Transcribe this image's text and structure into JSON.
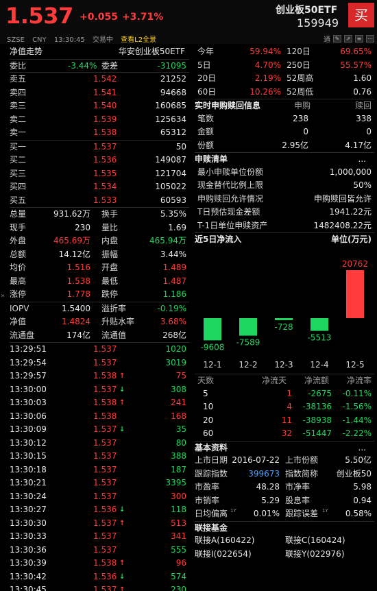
{
  "header": {
    "price": "1.537",
    "change": "+0.055",
    "change_pct": "+3.71%",
    "fund_name": "创业板50ETF",
    "code": "159949",
    "buy_label": "买",
    "exchange": "SZSE",
    "currency": "CNY",
    "time": "13:30:45",
    "status": "交易中",
    "l2_link": "查看L2全景",
    "tool_label": "通",
    "tool_icons": [
      "pencil-icon",
      "link-icon",
      "menu-icon",
      "more-icon"
    ]
  },
  "left": {
    "title": "净值走势",
    "subtitle": "华安创业板50ETF",
    "weibi_label": "委比",
    "weibi": "-3.44%",
    "weicha_label": "委差",
    "weicha": "-31095",
    "asks": [
      {
        "label": "卖五",
        "price": "1.542",
        "vol": "21252"
      },
      {
        "label": "卖四",
        "price": "1.541",
        "vol": "94668"
      },
      {
        "label": "卖三",
        "price": "1.540",
        "vol": "160685"
      },
      {
        "label": "卖二",
        "price": "1.539",
        "vol": "125634"
      },
      {
        "label": "卖一",
        "price": "1.538",
        "vol": "65312"
      }
    ],
    "bids": [
      {
        "label": "买一",
        "price": "1.537",
        "vol": "50"
      },
      {
        "label": "买二",
        "price": "1.536",
        "vol": "149087"
      },
      {
        "label": "买三",
        "price": "1.535",
        "vol": "121704"
      },
      {
        "label": "买四",
        "price": "1.534",
        "vol": "105022"
      },
      {
        "label": "买五",
        "price": "1.533",
        "vol": "60593"
      }
    ],
    "stats": [
      {
        "l1": "总量",
        "v1": "931.62万",
        "c1": "white",
        "l2": "换手",
        "v2": "5.35%",
        "c2": "white"
      },
      {
        "l1": "现手",
        "v1": "230",
        "c1": "white",
        "l2": "量比",
        "v2": "1.69",
        "c2": "white"
      },
      {
        "l1": "外盘",
        "v1": "465.69万",
        "c1": "red",
        "l2": "内盘",
        "v2": "465.94万",
        "c2": "green"
      },
      {
        "l1": "总额",
        "v1": "14.12亿",
        "c1": "white",
        "l2": "振幅",
        "v2": "3.44%",
        "c2": "white"
      },
      {
        "l1": "均价",
        "v1": "1.516",
        "c1": "red",
        "l2": "开盘",
        "v2": "1.489",
        "c2": "red"
      },
      {
        "l1": "最高",
        "v1": "1.538",
        "c1": "red",
        "l2": "最低",
        "v2": "1.487",
        "c2": "red"
      },
      {
        "l1": "涨停",
        "v1": "1.778",
        "c1": "red",
        "l2": "跌停",
        "v2": "1.186",
        "c2": "green"
      }
    ],
    "iopv": [
      {
        "l1": "IOPV",
        "v1": "1.5400",
        "c1": "white",
        "l2": "溢折率",
        "v2": "-0.19%",
        "c2": "green"
      },
      {
        "l1": "净值",
        "v1": "1.4824",
        "c1": "red",
        "l2": "升贴水率",
        "v2": "3.68%",
        "c2": "red"
      },
      {
        "l1": "流通盘",
        "v1": "174亿",
        "c1": "white",
        "l2": "流通值",
        "v2": "268亿",
        "c2": "white"
      }
    ],
    "ticks": [
      {
        "t": "13:29:51",
        "p": "1.537",
        "arrow": "",
        "v": "1020",
        "vc": "green"
      },
      {
        "t": "13:29:54",
        "p": "1.537",
        "arrow": "",
        "v": "3019",
        "vc": "green"
      },
      {
        "t": "13:29:57",
        "p": "1.538",
        "arrow": "up",
        "v": "75",
        "vc": "red"
      },
      {
        "t": "13:30:00",
        "p": "1.537",
        "arrow": "down",
        "v": "308",
        "vc": "green"
      },
      {
        "t": "13:30:03",
        "p": "1.538",
        "arrow": "up",
        "v": "241",
        "vc": "red"
      },
      {
        "t": "13:30:06",
        "p": "1.538",
        "arrow": "",
        "v": "168",
        "vc": "red"
      },
      {
        "t": "13:30:09",
        "p": "1.537",
        "arrow": "down",
        "v": "35",
        "vc": "green"
      },
      {
        "t": "13:30:12",
        "p": "1.537",
        "arrow": "",
        "v": "80",
        "vc": "green"
      },
      {
        "t": "13:30:15",
        "p": "1.537",
        "arrow": "",
        "v": "388",
        "vc": "green"
      },
      {
        "t": "13:30:18",
        "p": "1.537",
        "arrow": "",
        "v": "187",
        "vc": "green"
      },
      {
        "t": "13:30:21",
        "p": "1.537",
        "arrow": "",
        "v": "3395",
        "vc": "green"
      },
      {
        "t": "13:30:24",
        "p": "1.537",
        "arrow": "",
        "v": "300",
        "vc": "red"
      },
      {
        "t": "13:30:27",
        "p": "1.536",
        "arrow": "down",
        "v": "118",
        "vc": "green"
      },
      {
        "t": "13:30:30",
        "p": "1.537",
        "arrow": "up",
        "v": "513",
        "vc": "red"
      },
      {
        "t": "13:30:33",
        "p": "1.537",
        "arrow": "",
        "v": "341",
        "vc": "red"
      },
      {
        "t": "13:30:36",
        "p": "1.537",
        "arrow": "",
        "v": "555",
        "vc": "green"
      },
      {
        "t": "13:30:39",
        "p": "1.538",
        "arrow": "up",
        "v": "96",
        "vc": "red"
      },
      {
        "t": "13:30:42",
        "p": "1.536",
        "arrow": "down",
        "v": "574",
        "vc": "green"
      },
      {
        "t": "13:30:45",
        "p": "1.537",
        "arrow": "up",
        "v": "230",
        "vc": "green"
      }
    ]
  },
  "right": {
    "perf": [
      {
        "l1": "今年",
        "v1": "59.94%",
        "l2": "120日",
        "v2": "69.65%",
        "c2": "red"
      },
      {
        "l1": "5日",
        "v1": "4.70%",
        "l2": "250日",
        "v2": "55.57%",
        "c2": "red"
      },
      {
        "l1": "20日",
        "v1": "2.19%",
        "l2": "52周高",
        "v2": "1.60",
        "c2": "white"
      },
      {
        "l1": "60日",
        "v1": "10.26%",
        "l2": "52周低",
        "v2": "0.76",
        "c2": "white"
      }
    ],
    "realtime": {
      "title": "实时申购赎回信息",
      "col1": "申购",
      "col2": "赎回",
      "rows": [
        {
          "label": "笔数",
          "a": "238",
          "b": "338"
        },
        {
          "label": "金额",
          "a": "0",
          "b": "0"
        },
        {
          "label": "份额",
          "a": "2.95亿",
          "b": "4.17亿"
        }
      ]
    },
    "list": {
      "title": "申赎清单",
      "more": "...",
      "rows": [
        {
          "label": "最小申赎单位份额",
          "value": "1,000,000"
        },
        {
          "label": "现金替代比例上限",
          "value": "50%"
        },
        {
          "label": "申购赎回允许情况",
          "value": "申购赎回皆允许"
        },
        {
          "label": "T日预估现金差额",
          "value": "1941.22元"
        },
        {
          "label": "T-1日单位申赎资产",
          "value": "1482408.22元"
        }
      ]
    },
    "flow": {
      "title": "近5日净流入",
      "unit": "单位(万元)",
      "dates": [
        "12-1",
        "12-2",
        "12-3",
        "12-4",
        "12-5"
      ]
    },
    "flow_table": {
      "headers": [
        "天数",
        "净流天",
        "净流额",
        "净流率"
      ],
      "rows": [
        {
          "d": "5",
          "n": "1",
          "amt": "-2675",
          "rate": "-0.11%"
        },
        {
          "d": "10",
          "n": "4",
          "amt": "-38136",
          "rate": "-1.56%"
        },
        {
          "d": "20",
          "n": "11",
          "amt": "-38938",
          "rate": "-1.44%"
        },
        {
          "d": "60",
          "n": "32",
          "amt": "-51447",
          "rate": "-2.22%"
        }
      ]
    },
    "basic": {
      "title": "基本资料",
      "more": "...",
      "rows": [
        {
          "l1": "上市日期",
          "v1": "2016-07-22",
          "c1": "white",
          "l2": "上市份额",
          "v2": "5.50亿"
        },
        {
          "l1": "跟踪指数",
          "v1": "399673",
          "c1": "blue",
          "l2": "指数简称",
          "v2": "创业板50"
        },
        {
          "l1": "市盈率",
          "v1": "48.28",
          "c1": "white",
          "l2": "市净率",
          "v2": "5.98"
        },
        {
          "l1": "市销率",
          "v1": "5.29",
          "c1": "white",
          "l2": "股息率",
          "v2": "0.94"
        },
        {
          "l1": "日均偏离",
          "v1": "0.01%",
          "c1": "white",
          "l2": "跟踪误差",
          "v2": "0.58%"
        }
      ],
      "superscript": "1Y"
    },
    "linked": {
      "title": "联接基金",
      "items": [
        "联接A(160422)",
        "联接C(160424)",
        "联接I(022654)",
        "联接Y(022976)"
      ]
    }
  },
  "chart_data": {
    "type": "bar",
    "title": "近5日净流入",
    "ylabel": "单位(万元)",
    "categories": [
      "12-1",
      "12-2",
      "12-3",
      "12-4",
      "12-5"
    ],
    "values": [
      -9608,
      -7589,
      -728,
      -5513,
      20762
    ],
    "colors": {
      "positive": "#ff3b3b",
      "negative": "#1ed760"
    }
  }
}
